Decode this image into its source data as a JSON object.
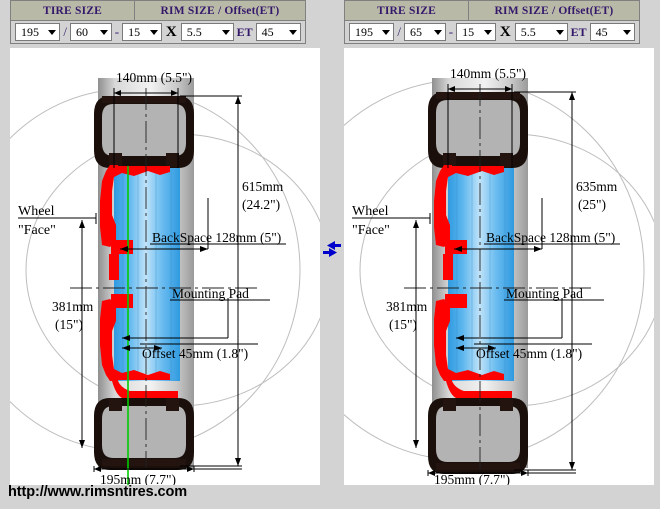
{
  "page": {
    "url_label": "http://www.rimsntires.com",
    "swap_icon": "swap-arrows-icon"
  },
  "panels": [
    {
      "id": "left",
      "header": {
        "tire_size_title": "TIRE SIZE",
        "rim_size_title": "RIM SIZE / Offset(ET)",
        "separator_slash": "/",
        "separator_dash": "-",
        "separator_x": "X",
        "separator_et": "ET",
        "tire_width": "195",
        "tire_aspect": "60",
        "rim_diameter": "15",
        "rim_width": "5.5",
        "offset_et": "45"
      },
      "labels": {
        "rim_width_dim": "140mm (5.5\")",
        "overall_diameter": "615mm",
        "overall_diameter_in": "(24.2\")",
        "wheel_face_1": "Wheel",
        "wheel_face_2": "\"Face\"",
        "backspace": "BackSpace 128mm (5\")",
        "mounting_pad": "Mounting Pad",
        "rim_diameter_mm": "381mm",
        "rim_diameter_in": "(15\")",
        "offset": "Offset 45mm (1.8\")",
        "tire_width_dim": "195mm (7.7\")"
      }
    },
    {
      "id": "right",
      "header": {
        "tire_size_title": "TIRE SIZE",
        "rim_size_title": "RIM SIZE / Offset(ET)",
        "separator_slash": "/",
        "separator_dash": "-",
        "separator_x": "X",
        "separator_et": "ET",
        "tire_width": "195",
        "tire_aspect": "65",
        "rim_diameter": "15",
        "rim_width": "5.5",
        "offset_et": "45"
      },
      "labels": {
        "rim_width_dim": "140mm (5.5\")",
        "overall_diameter": "635mm",
        "overall_diameter_in": "(25\")",
        "wheel_face_1": "Wheel",
        "wheel_face_2": "\"Face\"",
        "backspace": "BackSpace 128mm (5\")",
        "mounting_pad": "Mounting Pad",
        "rim_diameter_mm": "381mm",
        "rim_diameter_in": "(15\")",
        "offset": "Offset 45mm (1.8\")",
        "tire_width_dim": "195mm (7.7\")"
      }
    }
  ],
  "colors": {
    "header_title_bg": "#b9b9a8",
    "header_title_text": "#34196b",
    "panel_bg": "#d3d3d3",
    "rim_red": "#ff0000",
    "tire_black": "#1a0f0a",
    "tread_gray": "#b3b3b3",
    "air_blue": "#3aa0e8",
    "swap_blue": "#0000cc",
    "center_green": "#00cc00",
    "circle_gray": "#b0b0b0"
  }
}
